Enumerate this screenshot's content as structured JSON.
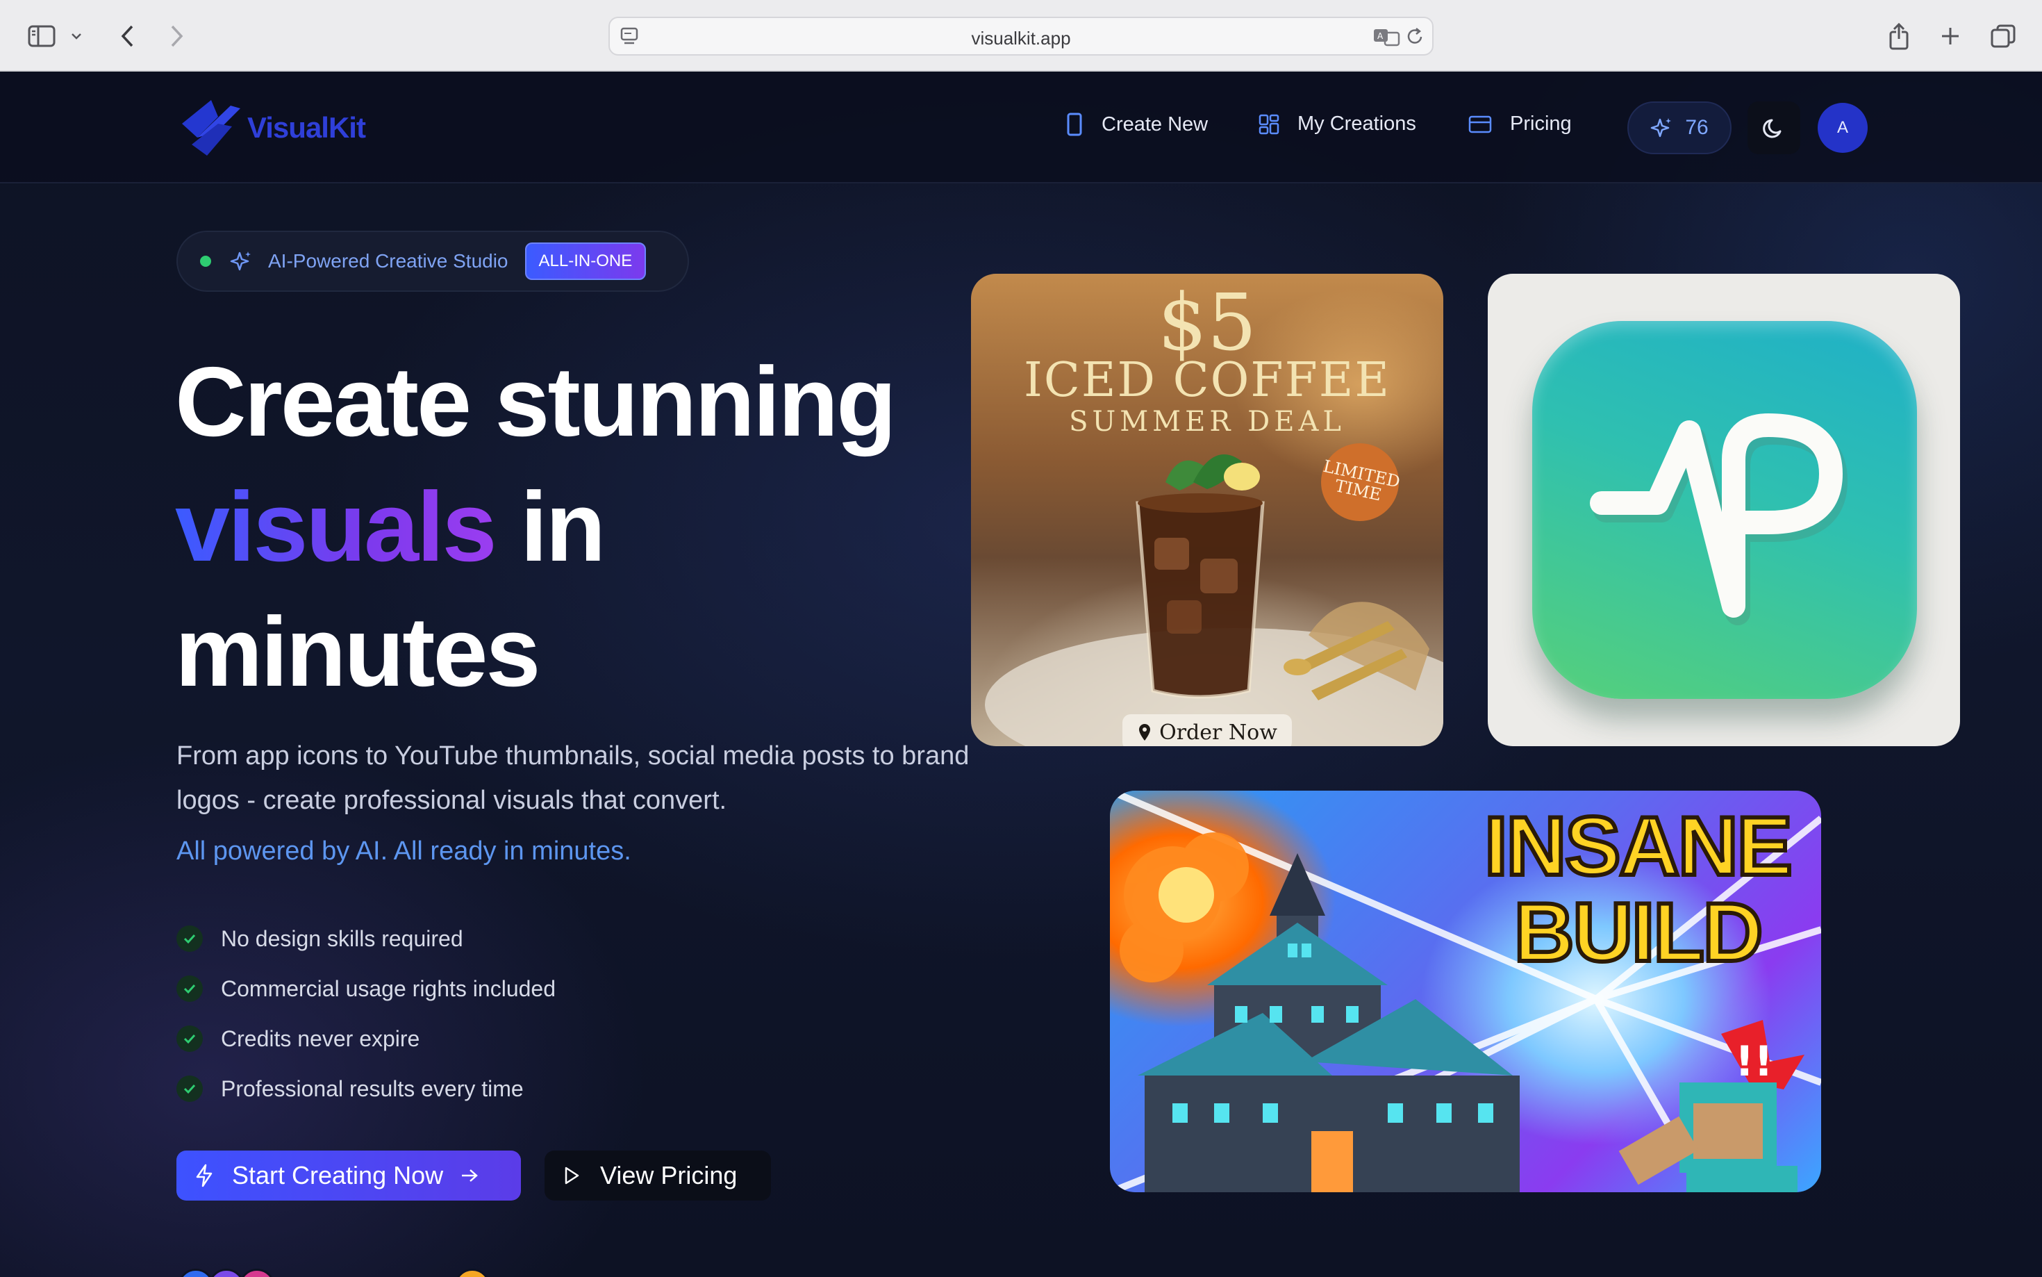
{
  "browser": {
    "url": "visualkit.app"
  },
  "nav": {
    "brand": "VisualKit",
    "items": [
      {
        "label": "Create New",
        "icon": "phone-icon"
      },
      {
        "label": "My Creations",
        "icon": "grid-icon"
      },
      {
        "label": "Pricing",
        "icon": "card-icon"
      }
    ],
    "credits": "76",
    "avatar_initial": "A"
  },
  "hero": {
    "pill_text": "AI-Powered Creative Studio",
    "pill_badge": "ALL-IN-ONE",
    "headline_line1": "Create stunning",
    "headline_accent": "visuals",
    "headline_line2_rest": "in",
    "headline_line3": "minutes",
    "subtitle": "From app icons to YouTube thumbnails, social media posts to brand logos - create professional visuals that convert.",
    "tagline": "All powered by AI. All ready in minutes.",
    "features": [
      "No design skills required",
      "Commercial usage rights included",
      "Credits never expire",
      "Professional results every time"
    ],
    "primary_cta": "Start Creating Now",
    "secondary_cta": "View Pricing"
  },
  "showcase": {
    "coffee": {
      "price": "$5",
      "title": "ICED COFFEE",
      "subtitle": "SUMMER DEAL",
      "badge_line1": "LIMITED",
      "badge_line2": "TIME",
      "button": "Order Now"
    },
    "thumbnail": {
      "line1": "INSANE",
      "line2": "BUILD"
    }
  },
  "colors": {
    "accent": "#3b5bff",
    "accent_purple": "#7c3aed",
    "link_blue": "#5d96f0",
    "success": "#2ecc71"
  }
}
